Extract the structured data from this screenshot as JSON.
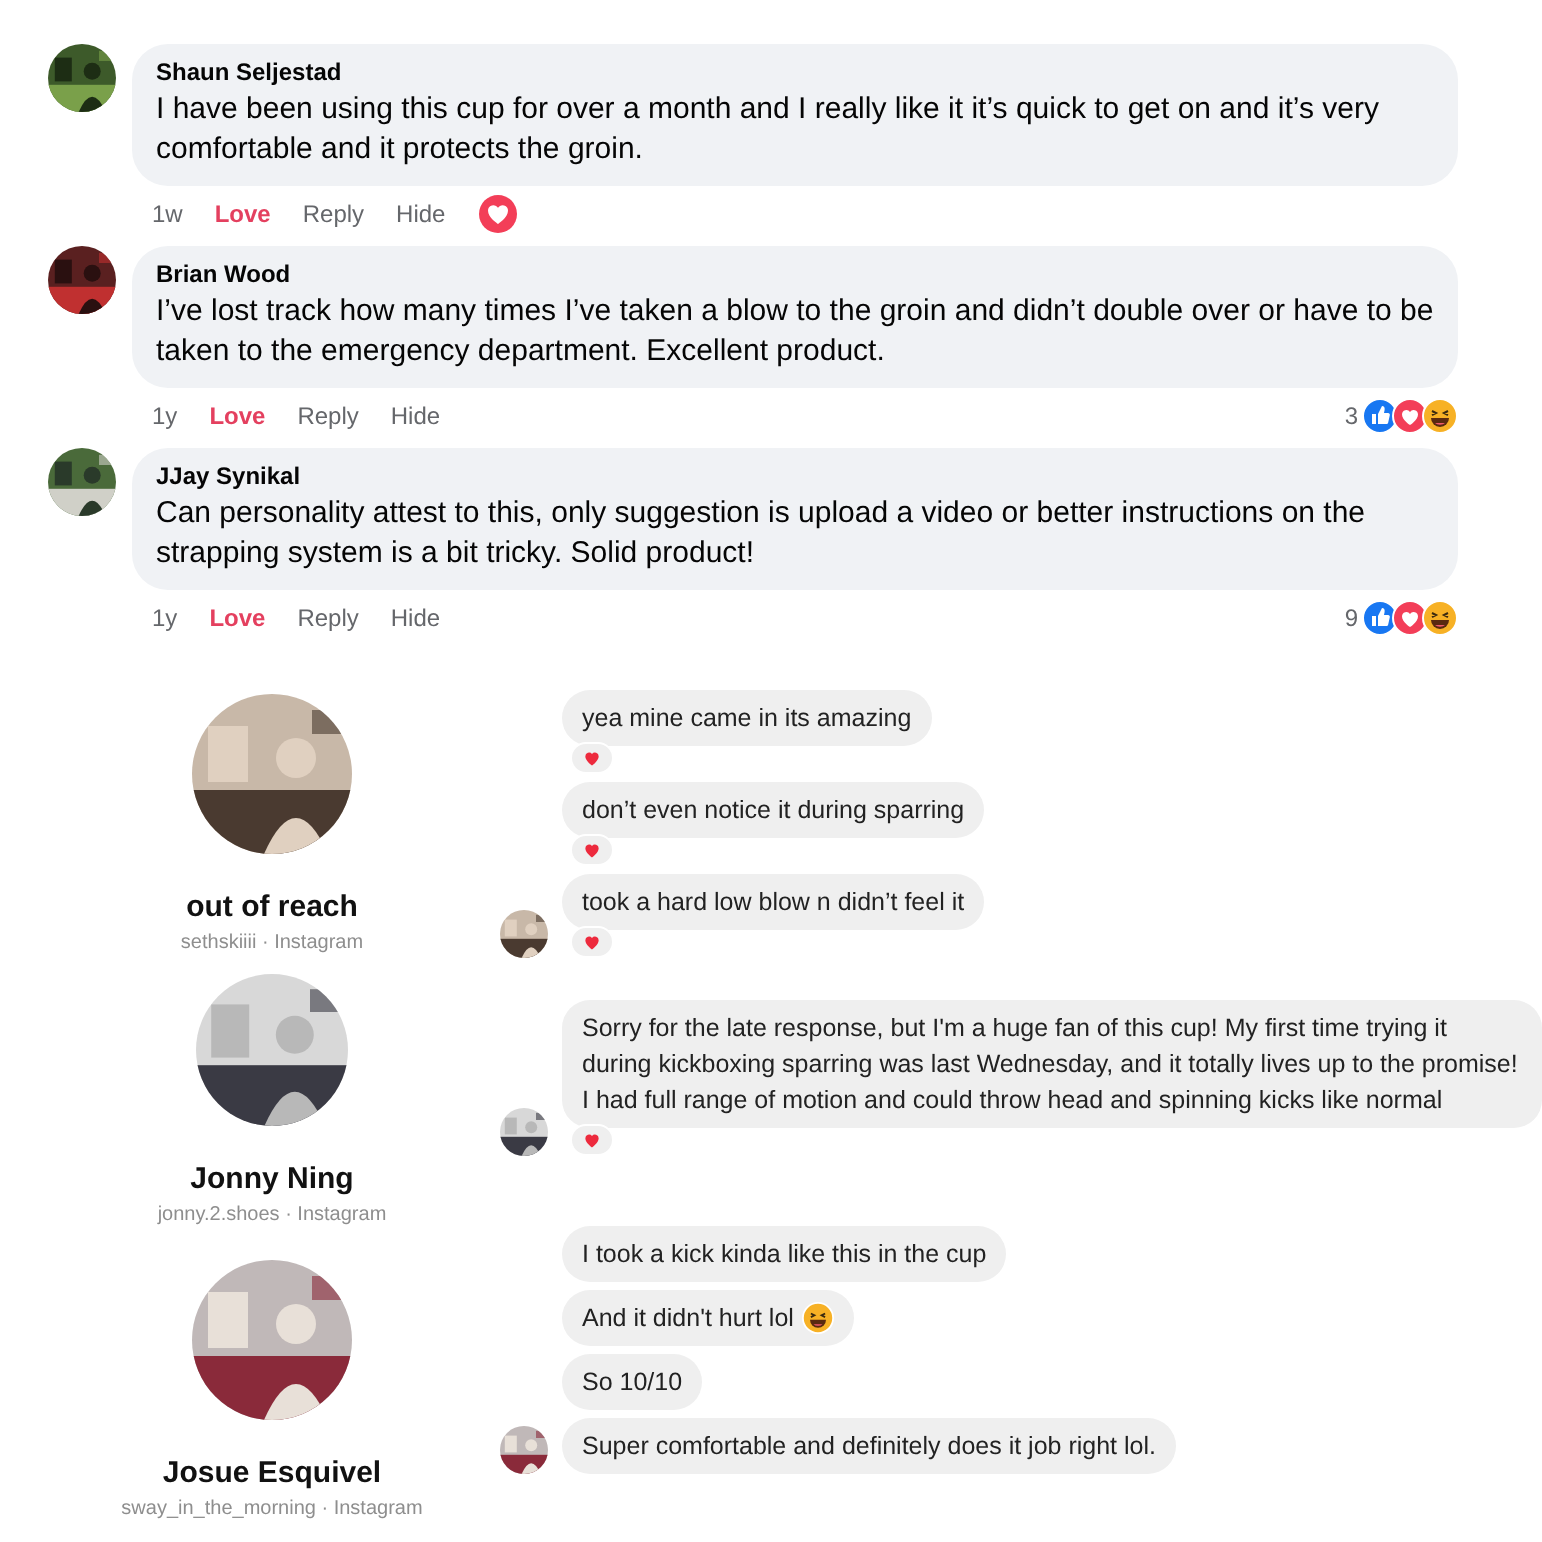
{
  "comments": [
    {
      "author": "Shaun Seljestad",
      "text": "I have been using this cup for over a month and I really like it it’s quick to get on and it’s very comfortable and it protects the groin.",
      "time": "1w",
      "actions": [
        {
          "label": "Love",
          "selected": true
        },
        {
          "label": "Reply",
          "selected": false
        },
        {
          "label": "Hide",
          "selected": false
        }
      ],
      "kind": "inline"
    },
    {
      "author": "Brian Wood",
      "text": "I’ve lost track how many times I’ve taken a blow to the groin and didn’t double over or have to be taken to the emergency department. Excellent product.",
      "time": "1y",
      "actions": [
        {
          "label": "Love",
          "selected": true
        },
        {
          "label": "Reply",
          "selected": false
        },
        {
          "label": "Hide",
          "selected": false
        }
      ],
      "kind": "summary",
      "reaction_count": "3"
    },
    {
      "author": "JJay Synikal",
      "text": "Can personality attest to this, only suggestion is upload a video or better instructions on the strapping system is a bit tricky. Solid product!",
      "time": "1y",
      "actions": [
        {
          "label": "Love",
          "selected": true
        },
        {
          "label": "Reply",
          "selected": false
        },
        {
          "label": "Hide",
          "selected": false
        }
      ],
      "kind": "summary",
      "reaction_count": "9"
    }
  ],
  "conversations": [
    {
      "name": "out of reach",
      "handle": "sethskiiii · Instagram",
      "messages": [
        {
          "text": "yea mine came in its amazing",
          "hearted": true,
          "show_avatar": false
        },
        {
          "text": "don’t even notice it during sparring",
          "hearted": true,
          "show_avatar": false
        },
        {
          "text": "took a hard low blow n didn’t feel it",
          "hearted": true,
          "show_avatar": true
        }
      ]
    },
    {
      "name": "Jonny Ning",
      "handle": "jonny.2.shoes · Instagram",
      "messages": [
        {
          "text": "Sorry for the late response, but I'm a huge fan of this cup! My first time trying it during kickboxing sparring was last Wednesday, and it totally lives up to the promise! I had full range of motion and could throw head and spinning kicks like normal",
          "hearted": true,
          "show_avatar": true
        }
      ]
    },
    {
      "name": "Josue Esquivel",
      "handle": "sway_in_the_morning · Instagram",
      "messages": [
        {
          "text": "I took a kick kinda like this in the cup",
          "hearted": false,
          "show_avatar": false
        },
        {
          "text": "And it didn't hurt lol",
          "hearted": false,
          "show_avatar": false,
          "laughing_emoji": true
        },
        {
          "text": "So 10/10",
          "hearted": false,
          "show_avatar": false
        },
        {
          "text": "Super comfortable and definitely does it job right lol.",
          "hearted": false,
          "show_avatar": true
        }
      ]
    }
  ]
}
